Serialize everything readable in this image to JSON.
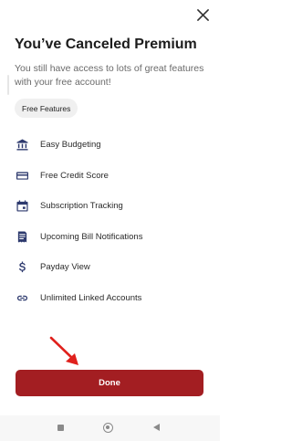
{
  "dialog": {
    "title": "You’ve Canceled Premium",
    "subtitle": "You still have access to lots of great features with your free account!",
    "chip_label": "Free Features"
  },
  "features": [
    {
      "label": "Easy Budgeting",
      "icon": "bank-icon"
    },
    {
      "label": "Free Credit Score",
      "icon": "credit-card-icon"
    },
    {
      "label": "Subscription Tracking",
      "icon": "calendar-icon"
    },
    {
      "label": "Upcoming Bill Notifications",
      "icon": "bill-icon"
    },
    {
      "label": "Payday View",
      "icon": "dollar-icon"
    },
    {
      "label": "Unlimited Linked Accounts",
      "icon": "link-icon"
    }
  ],
  "done_label": "Done",
  "colors": {
    "accent": "#a31e22",
    "icon": "#2e3a6e",
    "annotation_arrow": "#e0201c"
  }
}
